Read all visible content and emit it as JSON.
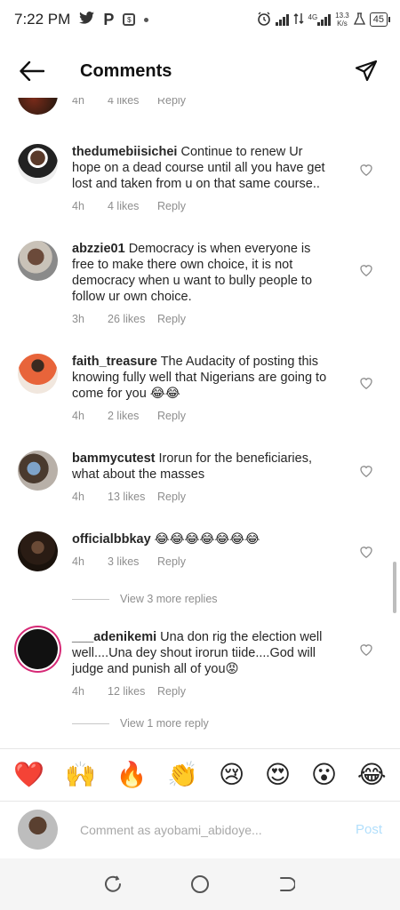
{
  "status_bar": {
    "time": "7:22 PM",
    "icons": [
      "twitter-icon",
      "p-icon",
      "app-icon",
      "dot-icon",
      "alarm-icon",
      "signal-icon",
      "data-arrows-icon",
      "signal-4g-icon"
    ],
    "network_type": "4G",
    "net_speed_value": "13.3",
    "net_speed_unit": "K/s",
    "battery": "45"
  },
  "header": {
    "title": "Comments"
  },
  "partial_comment": {
    "time": "4h",
    "likes": "4 likes",
    "reply": "Reply"
  },
  "comments": [
    {
      "username": "thedumebiisichei",
      "text": "Continue to renew Ur hope on a dead course until all you have get lost and taken from u on that same course..",
      "time": "4h",
      "likes": "4 likes",
      "reply": "Reply"
    },
    {
      "username": "abzzie01",
      "text": "Democracy is when everyone is free to make there own choice,  it is not democracy when u want to bully people to follow ur own choice.",
      "time": "3h",
      "likes": "26 likes",
      "reply": "Reply"
    },
    {
      "username": "faith_treasure",
      "text": "The Audacity of posting this knowing fully well that Nigerians are going to come for you 😂😂",
      "time": "4h",
      "likes": "2 likes",
      "reply": "Reply"
    },
    {
      "username": "bammycutest",
      "text": "Irorun for the beneficiaries, what about the masses",
      "time": "4h",
      "likes": "13 likes",
      "reply": "Reply"
    },
    {
      "username": "officialbbkay",
      "text": "😂😂😂😂😂😂😂",
      "time": "4h",
      "likes": "3 likes",
      "reply": "Reply",
      "view_replies": "View 3 more replies"
    },
    {
      "username": "___adenikemi",
      "text": "Una don rig the election well well....Una dey shout irorun tiide....God will judge and punish all of you😡",
      "time": "4h",
      "likes": "12 likes",
      "reply": "Reply",
      "view_replies": "View 1 more reply"
    }
  ],
  "emoji_bar": [
    "❤️",
    "🙌",
    "🔥",
    "👏",
    "😢",
    "😍",
    "😮",
    "😂"
  ],
  "comment_input": {
    "placeholder": "Comment as ayobami_abidoye...",
    "post_label": "Post"
  },
  "colors": {
    "text": "#262626",
    "meta": "#8e8e8e",
    "post_disabled": "#b2dffc",
    "divider": "#e6e6e6"
  }
}
